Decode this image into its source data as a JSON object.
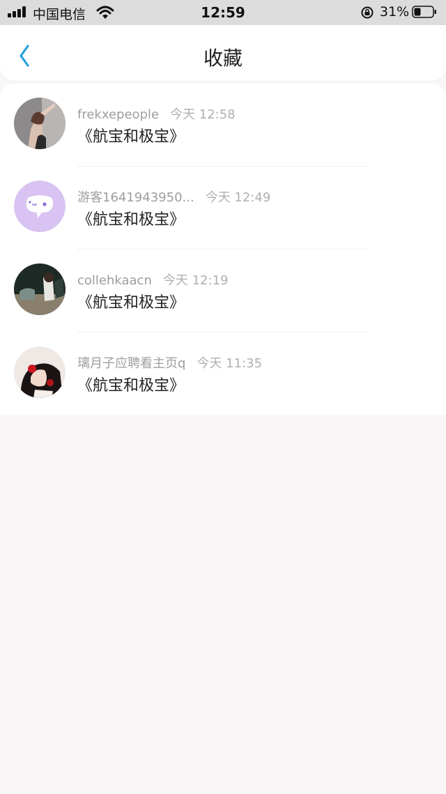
{
  "status_bar": {
    "carrier": "中国电信",
    "time": "12:59",
    "battery": "31%"
  },
  "header": {
    "title": "收藏"
  },
  "favorites": [
    {
      "user": "frekxepeople",
      "time": "今天 12:58",
      "title": "《航宝和极宝》"
    },
    {
      "user": "游客1641943950...",
      "time": "今天 12:49",
      "title": "《航宝和极宝》"
    },
    {
      "user": "collehkaacn",
      "time": "今天 12:19",
      "title": "《航宝和极宝》"
    },
    {
      "user": "璃月子应聘看主页q",
      "time": "今天 11:35",
      "title": "《航宝和极宝》"
    }
  ],
  "colors": {
    "accent": "#2a9fe0",
    "guest_avatar": "#d8c3f2"
  }
}
